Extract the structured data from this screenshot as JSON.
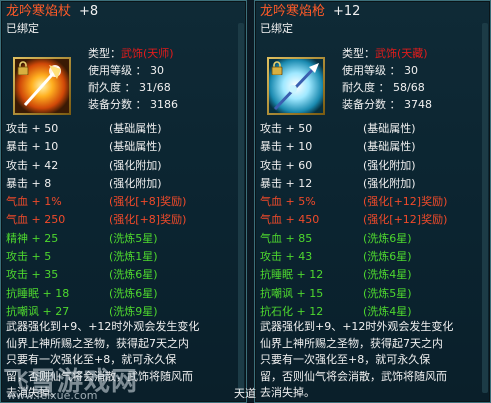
{
  "left": {
    "title": "龙吟寒焰杖",
    "plus": "+8",
    "bound": "已绑定",
    "type_label": "类型：",
    "type_value": "武饰(天师)",
    "level": "使用等级 ： 30",
    "durability": "耐久度 ： 31/68",
    "score": "装备分数 ： 3186",
    "stats": [
      {
        "k": "攻击 + 50",
        "v": "(基础属性)",
        "c": "white"
      },
      {
        "k": "暴击 + 10",
        "v": "(基础属性)",
        "c": "white"
      },
      {
        "k": "攻击 + 42",
        "v": "(强化附加)",
        "c": "white"
      },
      {
        "k": "暴击 + 8",
        "v": "(强化附加)",
        "c": "white"
      },
      {
        "k": "气血 + 1%",
        "v": "(强化[+8]奖励)",
        "c": "red"
      },
      {
        "k": "气血 + 250",
        "v": "(强化[+8]奖励)",
        "c": "red"
      },
      {
        "k": "精神 + 25",
        "v": "(洗炼5星)",
        "c": "green"
      },
      {
        "k": "攻击 + 5",
        "v": "(洗炼1星)",
        "c": "green"
      },
      {
        "k": "攻击 + 35",
        "v": "(洗炼6星)",
        "c": "green"
      },
      {
        "k": "抗睡眠 + 18",
        "v": "(洗炼6星)",
        "c": "green"
      },
      {
        "k": "抗嘲讽 + 27",
        "v": "(洗炼9星)",
        "c": "green"
      }
    ],
    "desc": [
      "武器强化到+9、+12时外观会发生变化",
      "仙界上神所赐之圣物，获得起7天之内",
      "只要有一次强化至+8，就可永久保",
      "留，否则仙气将会消散，武饰将随风而",
      "去消失掉。"
    ]
  },
  "right": {
    "title": "龙吟寒焰枪",
    "plus": "+12",
    "bound": "已绑定",
    "type_label": "类型：",
    "type_value": "武饰(天藏)",
    "level": "使用等级 ： 30",
    "durability": "耐久度 ： 58/68",
    "score": "装备分数 ： 3748",
    "stats": [
      {
        "k": "攻击 + 50",
        "v": "(基础属性)",
        "c": "white"
      },
      {
        "k": "暴击 + 10",
        "v": "(基础属性)",
        "c": "white"
      },
      {
        "k": "攻击 + 60",
        "v": "(强化附加)",
        "c": "white"
      },
      {
        "k": "暴击 + 12",
        "v": "(强化附加)",
        "c": "white"
      },
      {
        "k": "气血 + 5%",
        "v": "(强化[+12]奖励)",
        "c": "red"
      },
      {
        "k": "气血 + 450",
        "v": "(强化[+12]奖励)",
        "c": "red"
      },
      {
        "k": "气血 + 85",
        "v": "(洗炼6星)",
        "c": "green"
      },
      {
        "k": "攻击 + 43",
        "v": "(洗炼6星)",
        "c": "green"
      },
      {
        "k": "抗睡眠 + 12",
        "v": "(洗炼4星)",
        "c": "green"
      },
      {
        "k": "抗嘲讽 + 15",
        "v": "(洗炼5星)",
        "c": "green"
      },
      {
        "k": "抗石化 + 12",
        "v": "(洗炼4星)",
        "c": "green"
      }
    ],
    "desc": [
      "武器强化到+9、+12时外观会发生变化",
      "仙界上神所赐之圣物，获得起7天之内",
      "只要有一次强化至+8，就可永久保",
      "留，否则仙气将会消散，武饰将随风而",
      "去消失掉。"
    ]
  },
  "watermark": {
    "big": "飞雪游戏网",
    "small": "www.feixue.com"
  },
  "corner_label": "天道"
}
